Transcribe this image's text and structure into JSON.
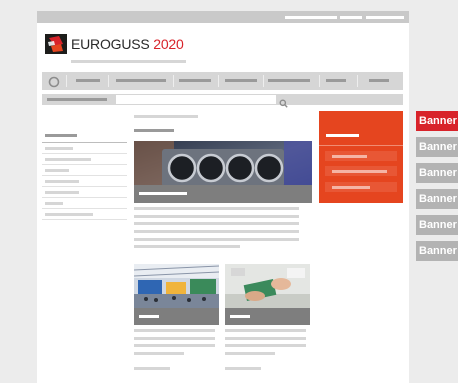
{
  "header": {
    "brand_name": "EUROGUSS",
    "brand_year": "2020",
    "logo_icon": "euroguss-logo-icon"
  },
  "icons": {
    "home": "home-icon",
    "search": "search-icon"
  },
  "banners": [
    {
      "label": "Banner",
      "color": "#d8232a"
    },
    {
      "label": "Banner",
      "color": "#b3b3b3"
    },
    {
      "label": "Banner",
      "color": "#b3b3b3"
    },
    {
      "label": "Banner",
      "color": "#b3b3b3"
    },
    {
      "label": "Banner",
      "color": "#b3b3b3"
    },
    {
      "label": "Banner",
      "color": "#b3b3b3"
    }
  ],
  "colors": {
    "accent_red": "#e5451f",
    "brand_red": "#d8232a",
    "placeholder_gray": "#d6d6d6",
    "caption_gray": "#7e7e7e"
  }
}
